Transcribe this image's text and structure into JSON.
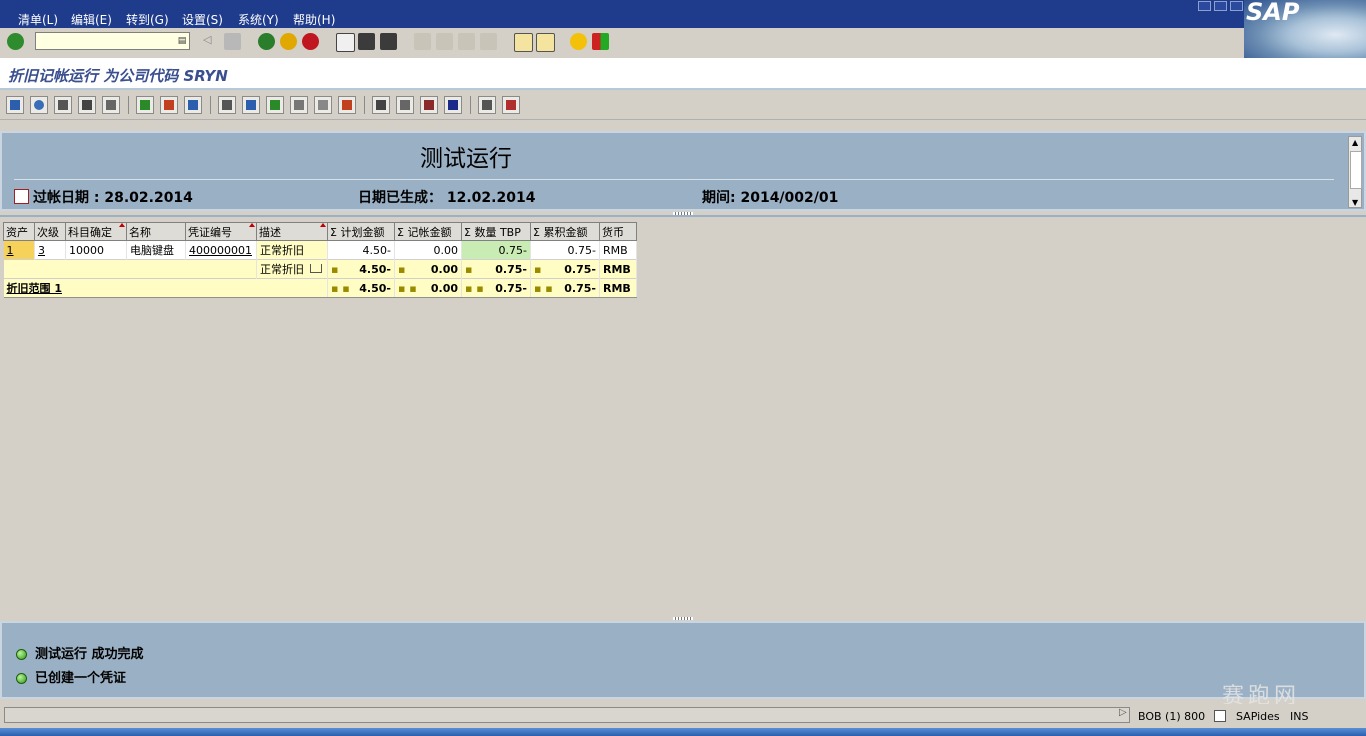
{
  "menu": [
    "清单(L)",
    "编辑(E)",
    "转到(G)",
    "设置(S)",
    "系统(Y)",
    "帮助(H)"
  ],
  "logo_text": "SAP",
  "command_field": {
    "value": ""
  },
  "title": "折旧记帐运行 为公司代码 SRYN",
  "header": {
    "heading": "测试运行",
    "posting_date": "过帐日期 : 28.02.2014",
    "created_date": "日期已生成： 12.02.2014",
    "period": "期间: 2014/002/01"
  },
  "columns": [
    "资产",
    "次级",
    "科目确定",
    "名称",
    "凭证编号",
    "描述",
    "Σ 计划金额",
    "Σ 记帐金额",
    "Σ 数量  TBP",
    "Σ 累积金额",
    "货币"
  ],
  "row": {
    "asset": "1",
    "subnumber": "3",
    "account_det": "10000",
    "name": "电脑键盘",
    "document": "400000001",
    "description": "正常折旧",
    "planned": "4.50-",
    "posted": "0.00",
    "tbp": "0.75-",
    "accumulated": "0.75-",
    "currency": "RMB"
  },
  "subtotal": {
    "description": "正常折旧",
    "planned": "4.50-",
    "posted": "0.00",
    "tbp": "0.75-",
    "accumulated": "0.75-",
    "currency": "RMB"
  },
  "total": {
    "label": "折旧范围  1",
    "planned": "4.50-",
    "posted": "0.00",
    "tbp": "0.75-",
    "accumulated": "0.75-",
    "currency": "RMB"
  },
  "total_markers": {
    "single": "▪",
    "double": "▪ ▪"
  },
  "messages": [
    "测试运行 成功完成",
    "已创建一个凭证"
  ],
  "status": {
    "system": "BOB (1) 800",
    "server": "SAPides",
    "mode": "INS"
  },
  "watermark": "赛跑网",
  "colors": {
    "menubar": "#1f3b8c",
    "panel": "#9ab0c4",
    "total_row": "#fffdc3",
    "selected_cell": "#f6d25a",
    "led": "#2d9b14"
  }
}
